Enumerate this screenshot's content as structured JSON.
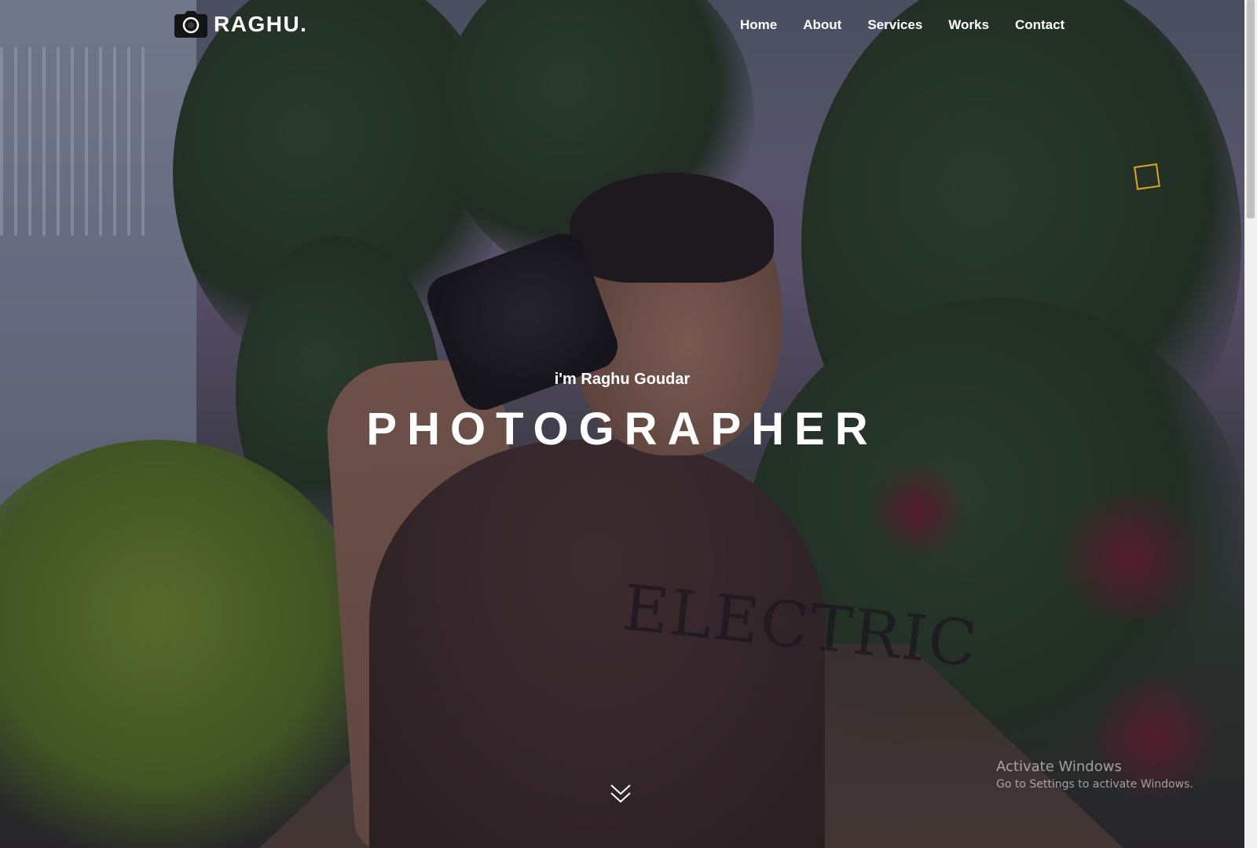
{
  "brand": {
    "logo_icon": "camera-icon",
    "name": "RAGHU."
  },
  "nav": {
    "items": [
      {
        "label": "Home"
      },
      {
        "label": "About"
      },
      {
        "label": "Services"
      },
      {
        "label": "Works"
      },
      {
        "label": "Contact"
      }
    ]
  },
  "hero": {
    "intro": "i'm Raghu Goudar",
    "title": "PHOTOGRAPHER",
    "scroll_icon": "chevron-double-down-icon",
    "accent_color": "#e0a12a"
  },
  "background": {
    "shirt_text": "ELECTRIC"
  },
  "os_watermark": {
    "title": "Activate Windows",
    "subtitle": "Go to Settings to activate Windows."
  }
}
